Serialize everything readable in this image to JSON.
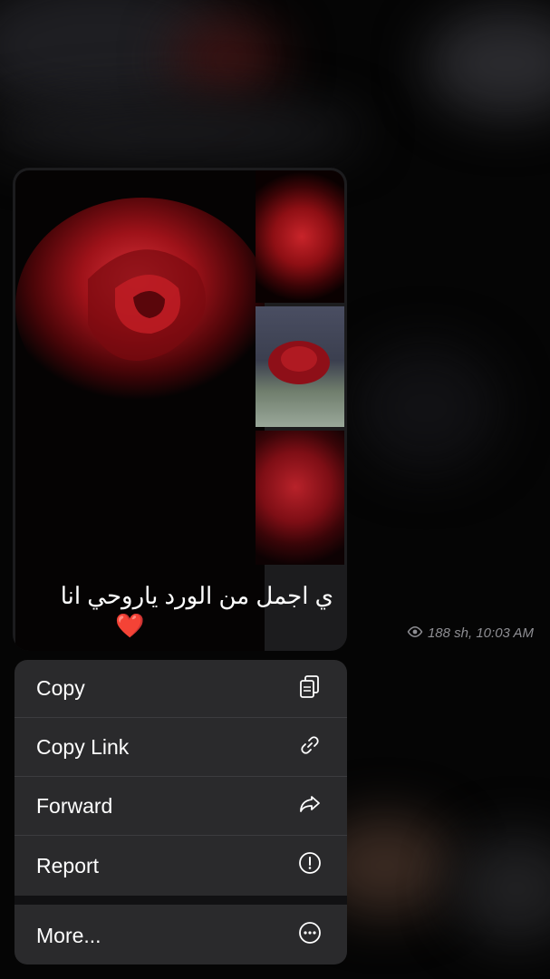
{
  "message": {
    "caption": "ي اجمل من الورد ياروحي انا",
    "emoji": "❤️",
    "views": "188 sh",
    "time": "10:03 AM",
    "meta_text": "188 sh, 10:03 AM"
  },
  "context_menu": {
    "items": [
      {
        "label": "Copy",
        "icon": "copy-icon"
      },
      {
        "label": "Copy Link",
        "icon": "link-icon"
      },
      {
        "label": "Forward",
        "icon": "forward-icon"
      },
      {
        "label": "Report",
        "icon": "report-icon"
      },
      {
        "label": "More...",
        "icon": "more-icon"
      }
    ]
  },
  "colors": {
    "menu_bg": "#2a2a2c",
    "bubble_bg": "#1c1c1e",
    "meta_text": "#8e8e93",
    "rose_red": "#b8141c"
  }
}
